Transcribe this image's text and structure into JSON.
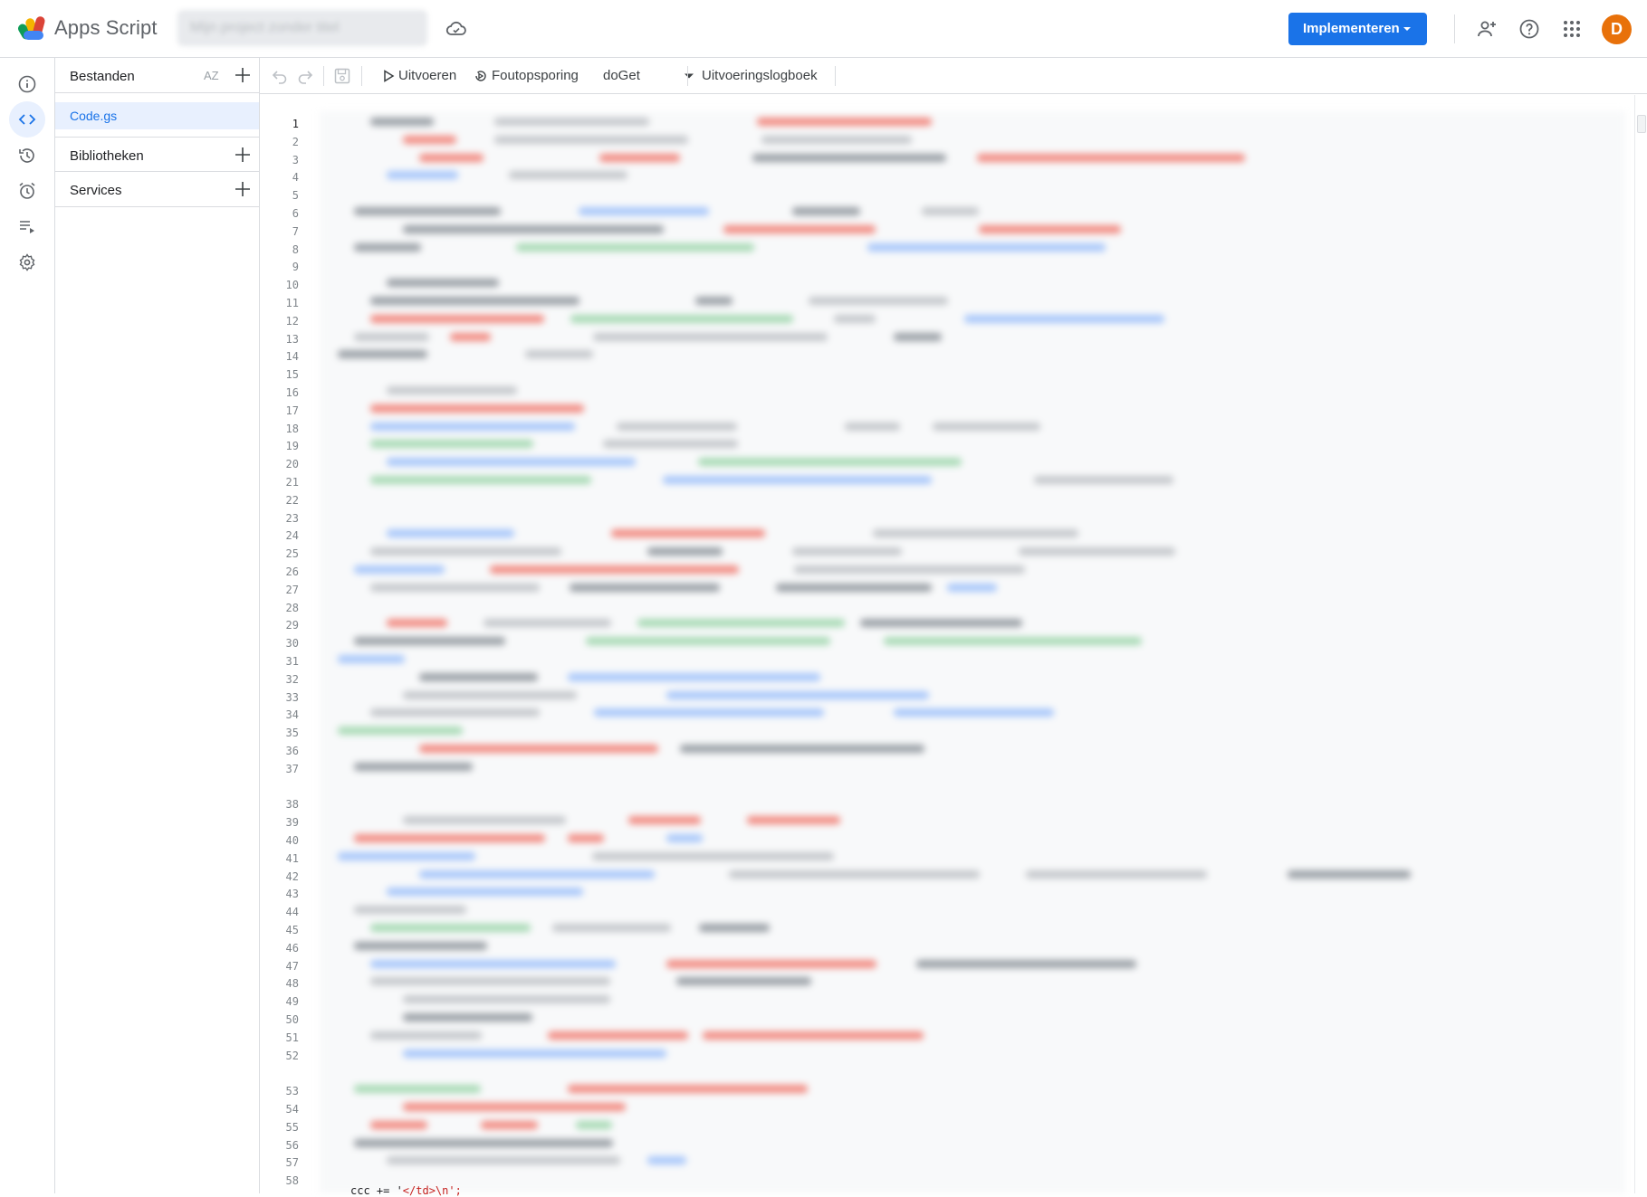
{
  "header": {
    "app_title": "Apps Script",
    "project_name": "Mijn project zonder titel",
    "deploy_label": "Implementeren",
    "avatar_letter": "D",
    "accent_color": "#1a73e8",
    "avatar_color": "#e8710a",
    "icons": [
      "apps-script-logo",
      "cloud-saved-icon",
      "add-person-icon",
      "help-icon",
      "apps-grid-icon"
    ]
  },
  "rail": {
    "items": [
      {
        "name": "overview",
        "icon": "info-icon"
      },
      {
        "name": "editor",
        "icon": "code-icon",
        "active": true
      },
      {
        "name": "versions",
        "icon": "history-icon"
      },
      {
        "name": "triggers",
        "icon": "alarm-icon"
      },
      {
        "name": "executions",
        "icon": "executions-icon"
      },
      {
        "name": "settings",
        "icon": "gear-icon"
      }
    ]
  },
  "files_panel": {
    "files_title": "Bestanden",
    "sort_label": "AZ",
    "files": [
      {
        "name": "Code.gs",
        "active": true
      }
    ],
    "libraries_title": "Bibliotheken",
    "services_title": "Services"
  },
  "toolbar": {
    "run_label": "Uitvoeren",
    "debug_label": "Foutopsporing",
    "function_selected": "doGet",
    "log_label": "Uitvoeringslogboek"
  },
  "editor": {
    "current_line": 1,
    "visible_code_prefix": "ccc += '",
    "visible_code_string": "</td>\\n';"
  }
}
